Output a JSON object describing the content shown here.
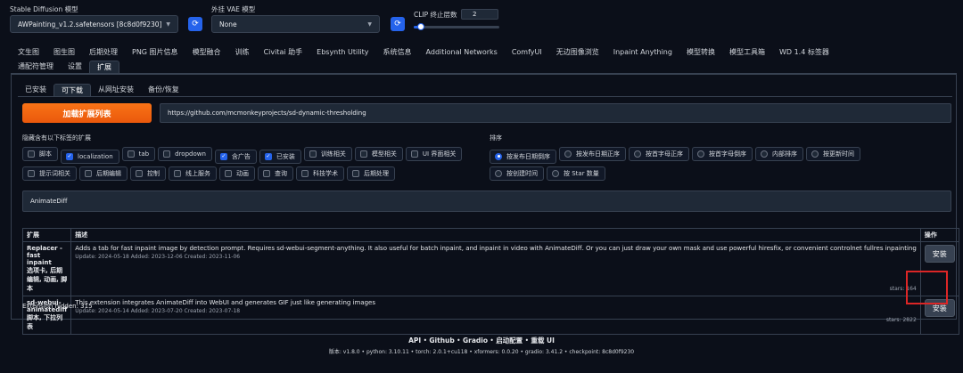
{
  "top": {
    "model_label": "Stable Diffusion 模型",
    "model_value": "AWPainting_v1.2.safetensors [8c8d0f9230]",
    "vae_label": "外挂 VAE 模型",
    "vae_value": "None",
    "clip_label": "CLIP 终止层数",
    "clip_value": "2",
    "clip_fraction": 0.08
  },
  "main_tabs_row1": [
    "文生图",
    "图生图",
    "后期处理",
    "PNG 图片信息",
    "模型融合",
    "训练",
    "Civitai 助手",
    "Ebsynth Utility",
    "系统信息",
    "Additional Networks",
    "ComfyUI",
    "无边图像浏览",
    "Inpaint Anything",
    "模型转换",
    "模型工具箱",
    "WD 1.4 标签器"
  ],
  "main_tabs_row2": [
    "通配符管理",
    "设置",
    "扩展"
  ],
  "sub_tabs": [
    "已安装",
    "可下载",
    "从网址安装",
    "备份/恢复"
  ],
  "load_button": "加载扩展列表",
  "url_value": "https://github.com/mcmonkeyprojects/sd-dynamic-thresholding",
  "hide_label": "隐藏含有以下标签的扩展",
  "hide_row1": [
    {
      "label": "脚本",
      "checked": false
    },
    {
      "label": "localization",
      "checked": true
    },
    {
      "label": "tab",
      "checked": false
    },
    {
      "label": "dropdown",
      "checked": false
    },
    {
      "label": "含广告",
      "checked": true
    },
    {
      "label": "已安装",
      "checked": true
    },
    {
      "label": "训练相关",
      "checked": false
    },
    {
      "label": "模型相关",
      "checked": false
    },
    {
      "label": "UI 界面相关",
      "checked": false
    }
  ],
  "hide_row2": [
    {
      "label": "提示词相关",
      "checked": false
    },
    {
      "label": "后期编辑",
      "checked": false
    },
    {
      "label": "控制",
      "checked": false
    },
    {
      "label": "线上服务",
      "checked": false
    },
    {
      "label": "动画",
      "checked": false
    },
    {
      "label": "查询",
      "checked": false
    },
    {
      "label": "科技学术",
      "checked": false
    },
    {
      "label": "后期处理",
      "checked": false
    }
  ],
  "sort_label": "排序",
  "sort_row1": [
    {
      "label": "按发布日期倒序",
      "selected": true
    },
    {
      "label": "按发布日期正序",
      "selected": false
    },
    {
      "label": "按首字母正序",
      "selected": false
    },
    {
      "label": "按首字母倒序",
      "selected": false
    },
    {
      "label": "内部排序",
      "selected": false
    },
    {
      "label": "按更新时间",
      "selected": false
    }
  ],
  "sort_row2": [
    {
      "label": "按创建时间",
      "selected": false
    },
    {
      "label": "按 Star 数量",
      "selected": false
    }
  ],
  "search_value": "AnimateDiff",
  "table": {
    "headers": [
      "扩展",
      "描述",
      "操作"
    ],
    "rows": [
      {
        "name": "Replacer - fast inpaint",
        "tags": "选项卡, 后期编辑, 动画, 脚本",
        "desc": "Adds a tab for fast inpaint image by detection prompt. Requires sd-webui-segment-anything. It also useful for batch inpaint, and inpaint in video with AnimateDiff. Or you can just draw your own mask and use powerful hiresfix, or convenient controlnet fullres inpainting",
        "dates": "Update: 2024-05-18 Added: 2023-12-06 Created: 2023-11-06",
        "stars": "stars: 164",
        "action": "安装"
      },
      {
        "name": "sd-webui-animatediff",
        "tags": "脚本, 下拉列表",
        "desc": "This extension integrates AnimateDiff into WebUI and generates GIF just like generating images",
        "dates": "Update: 2024-05-14 Added: 2023-07-20 Created: 2023-07-18",
        "stars": "stars: 2822",
        "action": "安装"
      }
    ]
  },
  "hidden_text": "Extension hidden: 315",
  "footer": {
    "links": [
      "API",
      "Github",
      "Gradio",
      "启动配置",
      "重载 UI"
    ],
    "version": "版本: v1.8.0  •  python: 3.10.11  •  torch: 2.0.1+cu118  •  xformers: 0.0.20  •  gradio: 3.41.2  •  checkpoint: 8c8d0f9230"
  },
  "colors": {
    "accent": "#2563eb",
    "orange": "#f97316",
    "highlight": "#dc2626"
  }
}
